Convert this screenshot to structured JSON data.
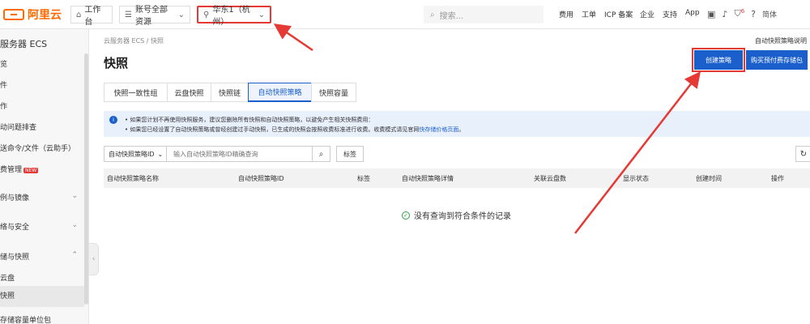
{
  "topbar": {
    "logo_text": "阿里云",
    "workbench": "工作台",
    "account": "账号全部资源",
    "region": "华东1（杭州）",
    "search_placeholder": "搜索...",
    "nav": [
      "费用",
      "工单",
      "ICP 备案",
      "企业",
      "支持",
      "App"
    ],
    "notify_badge": "6",
    "lang": "简体"
  },
  "sidebar": {
    "title": "服务器 ECS",
    "items": [
      {
        "label": "览"
      },
      {
        "label": "件"
      },
      {
        "label": "作"
      },
      {
        "label": "动问题排查"
      },
      {
        "label": "送命令/文件（云助手）"
      },
      {
        "label": "费管理",
        "tag": "NEW"
      },
      {
        "label": "例与镜像"
      },
      {
        "label": "络与安全"
      },
      {
        "label": "储与快照"
      },
      {
        "label": "云盘"
      },
      {
        "label": "快照"
      },
      {
        "label": "存储容量单位包"
      }
    ]
  },
  "breadcrumb": "云服务器 ECS / 快照",
  "help_link": "自动快照策略说明",
  "page_title": "快照",
  "buttons": {
    "create": "创建策略",
    "buy": "购买预付费存储包"
  },
  "tabs": [
    "快照一致性组",
    "云盘快照",
    "快照链",
    "自动快照策略",
    "快照容量"
  ],
  "active_tab_index": 3,
  "notice": {
    "line1": "• 如果您计划不再使用快照服务，建议您删除所有快照和自动快照策略，以避免产生相关快照费用：",
    "line2_text": "• 如果您已经设置了自动快照策略或曾经创建过手动快照，已生成的快照会按照收费标准进行收费。收费模式请见官网",
    "line2_link": "快存储价格页面",
    "line2_end": "。"
  },
  "filter": {
    "select": "自动快照策略ID",
    "placeholder": "输入自动快照策略ID精确查询",
    "tag_button": "标签"
  },
  "table": {
    "headers": [
      "自动快照策略名称",
      "自动快照策略ID",
      "标签",
      "自动快照策略详情",
      "关联云盘数",
      "显示状态",
      "创建时间",
      "操作"
    ],
    "empty_text": "没有查询到符合条件的记录"
  },
  "colors": {
    "brand": "#ff6a00",
    "primary": "#1a5fcc",
    "annotation": "#e53935"
  }
}
